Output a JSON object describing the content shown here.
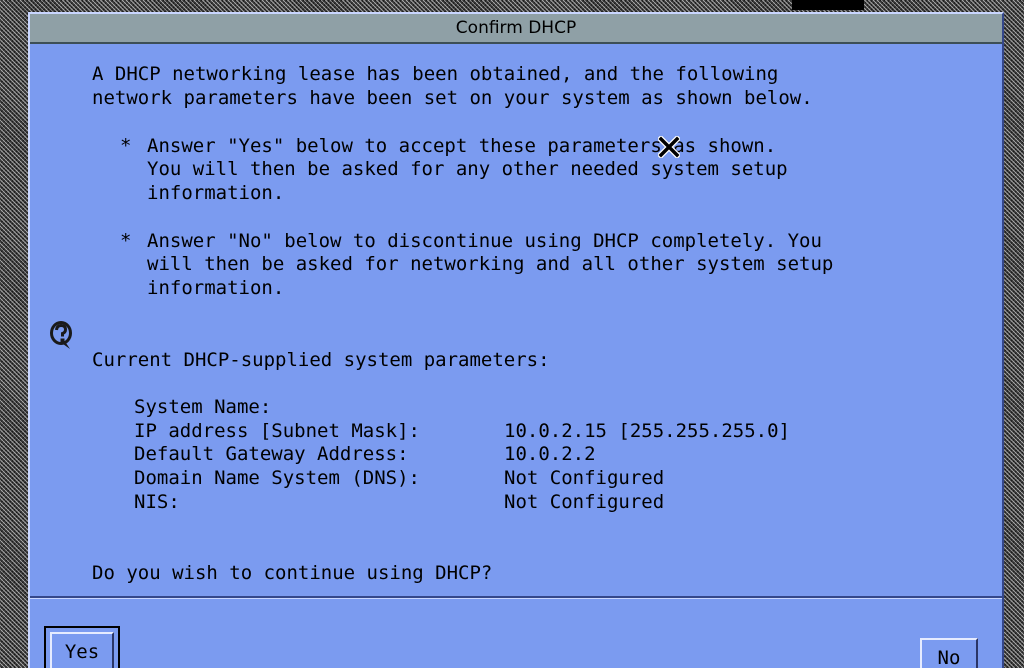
{
  "window": {
    "title": "Confirm DHCP"
  },
  "intro": {
    "line1": "A DHCP networking lease has been obtained, and the following",
    "line2": "network parameters have been set on your system as shown below."
  },
  "bullets": [
    {
      "star": "*",
      "lines": [
        "Answer \"Yes\" below to accept these parameters as shown.",
        "You will then be asked for any other needed system setup",
        "information."
      ]
    },
    {
      "star": "*",
      "lines": [
        "Answer \"No\" below to discontinue using DHCP completely. You",
        "will then be asked for networking and all other system setup",
        "information."
      ]
    }
  ],
  "params": {
    "heading": "Current DHCP-supplied system parameters:",
    "rows": [
      {
        "label": "System Name:",
        "value": ""
      },
      {
        "label": "IP address [Subnet Mask]:",
        "value": "10.0.2.15 [255.255.255.0]"
      },
      {
        "label": "Default Gateway Address:",
        "value": "10.0.2.2"
      },
      {
        "label": "Domain Name System (DNS):",
        "value": "Not Configured"
      },
      {
        "label": "NIS:",
        "value": "Not Configured"
      }
    ]
  },
  "question": "Do you wish to continue using DHCP?",
  "buttons": {
    "yes_label": "Yes",
    "no_label": "No"
  },
  "icons": {
    "help": "help-question-icon",
    "cursor": "x-cursor-icon"
  },
  "colors": {
    "dialog_background": "#7b9bf0",
    "titlebar_background": "#8fa0a6"
  }
}
